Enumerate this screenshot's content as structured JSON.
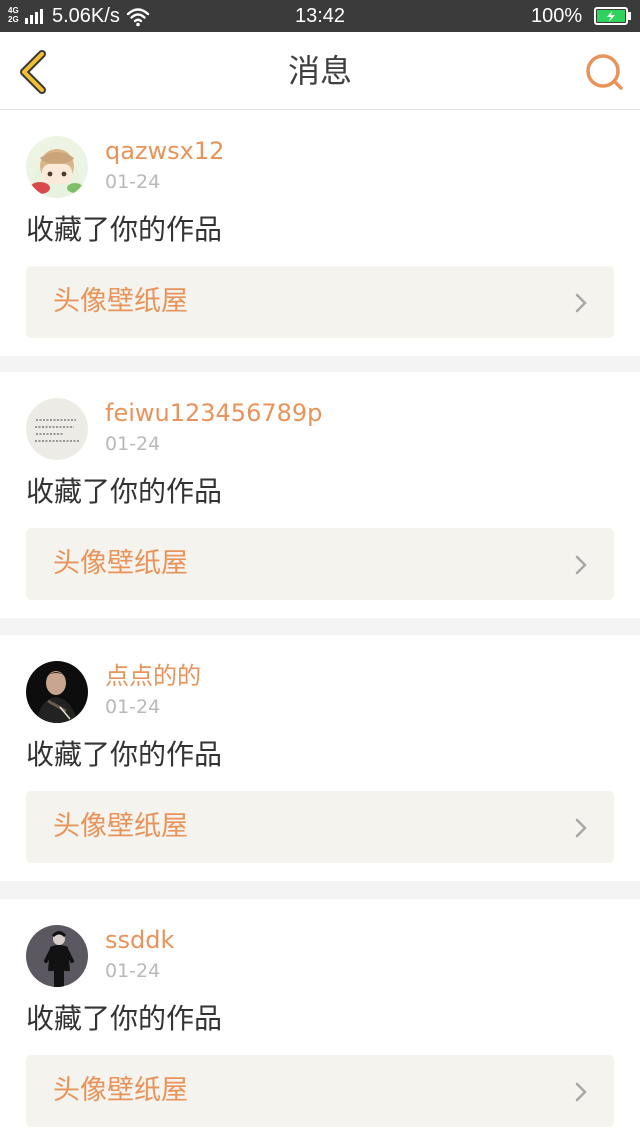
{
  "status_bar": {
    "network_top": "4G",
    "network_bottom": "2G",
    "speed": "5.06K/s",
    "time": "13:42",
    "battery": "100%"
  },
  "nav": {
    "title": "消息",
    "back_icon": "chevron-left-icon",
    "search_icon": "search-icon"
  },
  "colors": {
    "accent": "#e8935a",
    "back_icon": "#f2c12e",
    "text_primary": "#333333",
    "text_muted": "#b9b9b9",
    "work_box_bg": "#f5f3ee",
    "battery": "#2fd35c"
  },
  "notifications": [
    {
      "username": "qazwsx12",
      "date": "01-24",
      "action": "收藏了你的作品",
      "work_title": "头像壁纸屋",
      "avatar_icon": "cartoon-girl-avatar"
    },
    {
      "username": "feiwu123456789p",
      "date": "01-24",
      "action": "收藏了你的作品",
      "work_title": "头像壁纸屋",
      "avatar_icon": "handwriting-avatar"
    },
    {
      "username": "点点的的",
      "date": "01-24",
      "action": "收藏了你的作品",
      "work_title": "头像壁纸屋",
      "avatar_icon": "dark-portrait-avatar"
    },
    {
      "username": "ssddk",
      "date": "01-24",
      "action": "收藏了你的作品",
      "work_title": "头像壁纸屋",
      "avatar_icon": "standing-figure-avatar"
    }
  ]
}
